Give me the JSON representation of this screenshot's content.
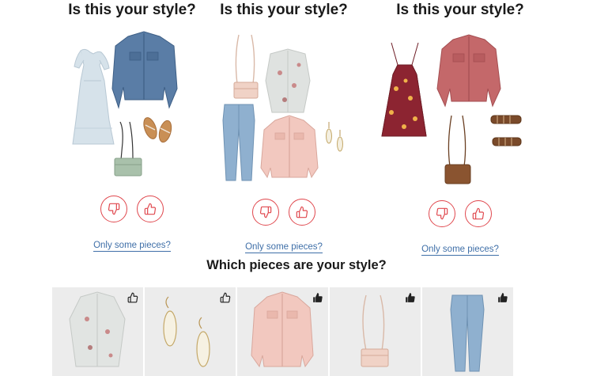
{
  "outfit_cards": [
    {
      "title": "Is this your style?",
      "items": [
        "light-blue-tiered-dress",
        "denim-jacket",
        "sage-crossbody-bag",
        "tan-strappy-sandals"
      ],
      "dislike_icon": "thumbs-down-icon",
      "like_icon": "thumbs-up-icon",
      "some_pieces_link": "Only some pieces?"
    },
    {
      "title": "Is this your style?",
      "items": [
        "blush-crossbody-bag",
        "floral-kimono",
        "light-wash-jeans",
        "blush-jacket",
        "drop-earrings"
      ],
      "dislike_icon": "thumbs-down-icon",
      "like_icon": "thumbs-up-icon",
      "some_pieces_link": "Only some pieces?"
    },
    {
      "title": "Is this your style?",
      "items": [
        "burgundy-floral-dress",
        "dusty-rose-jacket",
        "brown-crossbody-bag",
        "brown-gladiator-sandals"
      ],
      "dislike_icon": "thumbs-down-icon",
      "like_icon": "thumbs-up-icon",
      "some_pieces_link": "Only some pieces?"
    }
  ],
  "pieces_section": {
    "title": "Which pieces are your style?",
    "pieces": [
      {
        "item": "floral-kimono",
        "thumb_state": "outline"
      },
      {
        "item": "drop-earrings",
        "thumb_state": "outline"
      },
      {
        "item": "blush-jacket",
        "thumb_state": "filled"
      },
      {
        "item": "blush-crossbody-bag",
        "thumb_state": "filled"
      },
      {
        "item": "light-wash-jeans",
        "thumb_state": "filled"
      }
    ]
  },
  "colors": {
    "accent_red": "#e0484e",
    "link_blue": "#3f6fa8",
    "piece_bg": "#ececec",
    "title_text": "#1a1a1a"
  }
}
